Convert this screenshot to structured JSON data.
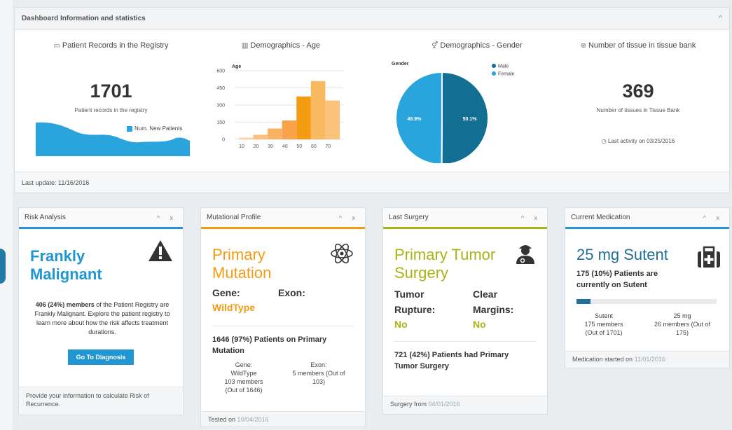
{
  "dashboard": {
    "title": "Dashboard Information and statistics",
    "collapse_glyph": "^",
    "last_update": "Last update: 11/16/2016",
    "records": {
      "title": "Patient Records in the Registry",
      "icon": "laptop-icon",
      "value": "1701",
      "caption": "Patient records in the registry",
      "legend": "Num. New Patients",
      "color": "#2aa4dc"
    },
    "age": {
      "title": "Demographics - Age",
      "icon": "bar-chart-icon"
    },
    "gender": {
      "title": "Demographics - Gender",
      "icon": "gender-icon"
    },
    "tissue": {
      "title": "Number of tissue in tissue bank",
      "icon": "tissue-icon",
      "value": "369",
      "caption": "Number of tissues in Tissue Bank",
      "activity": "Last activity on 03/25/2016"
    }
  },
  "chart_data": [
    {
      "type": "bar",
      "title": "Age",
      "categories": [
        "10",
        "20",
        "30",
        "40",
        "50",
        "60",
        "70"
      ],
      "values": [
        15,
        40,
        95,
        165,
        375,
        510,
        340
      ],
      "ylim": [
        0,
        600
      ],
      "yticks": [
        "0",
        "150",
        "300",
        "450",
        "600"
      ],
      "xticks": [
        "10",
        "20",
        "30",
        "40",
        "50",
        "60",
        "70"
      ],
      "colors": [
        "#fcd19b",
        "#fbc17c",
        "#f9b164",
        "#f8a24a",
        "#f39c12",
        "#f8b960",
        "#fbc27a"
      ]
    },
    {
      "type": "pie",
      "title": "Gender",
      "series": [
        {
          "name": "Male",
          "value": 50.1,
          "label": "50.1%",
          "color": "#136e93"
        },
        {
          "name": "Female",
          "value": 49.9,
          "label": "49.9%",
          "color": "#2aa4dc"
        }
      ]
    }
  ],
  "cards": {
    "risk": {
      "title": "Risk Analysis",
      "accent": "#2196d3",
      "heading_line1": "Frankly",
      "heading_line2": "Malignant",
      "desc_bold": "406 (24%) members",
      "desc_rest": " of the Patient Registry are Frankly Malignant. Explore the patient registry to learn more about how the risk affects treatment durations.",
      "button": "Go To Diagnosis",
      "footer": "Provide your information to calculate Risk of Recurrence."
    },
    "mutation": {
      "title": "Mutational Profile",
      "accent": "#f39c12",
      "heading_line1": "Primary",
      "heading_line2": "Mutation",
      "gene_label": "Gene:",
      "exon_label": "Exon:",
      "gene_value": "WildType",
      "summary_line1": "1646 (97%) Patients on Primary",
      "summary_line2": "Mutation",
      "left_1": "Gene:",
      "left_2": "WildType",
      "left_3": "103 members",
      "left_4": "(Out of 1646)",
      "right_1": "Exon:",
      "right_2": "5 members (Out of",
      "right_3": "103)",
      "footer_label": "Tested on ",
      "footer_date": "10/04/2016"
    },
    "surgery": {
      "title": "Last Surgery",
      "accent": "#a8b414",
      "heading_line1": "Primary Tumor",
      "heading_line2": "Surgery",
      "tr_label_1": "Tumor",
      "tr_label_2": "Rupture:",
      "cm_label_1": "Clear",
      "cm_label_2": "Margins:",
      "tr_value": "No",
      "cm_value": "No",
      "summary_line1": "721 (42%) Patients had Primary",
      "summary_line2": "Tumor Surgery",
      "footer_label": "Surgery from ",
      "footer_date": "04/01/2016"
    },
    "medication": {
      "title": "Current Medication",
      "accent": "#2196d3",
      "heading": "25 mg Sutent",
      "summary_line1": "175 (10%) Patients are",
      "summary_line2": "currently on Sutent",
      "progress": 0.1,
      "left_1": "Sutent",
      "left_2": "175 members",
      "left_3": "(Out of 1701)",
      "right_1": "25 mg",
      "right_2": "26 members (Out of",
      "right_3": "175)",
      "footer_label": "Medication started on ",
      "footer_date": "11/01/2016"
    }
  },
  "card_controls": "^ x"
}
